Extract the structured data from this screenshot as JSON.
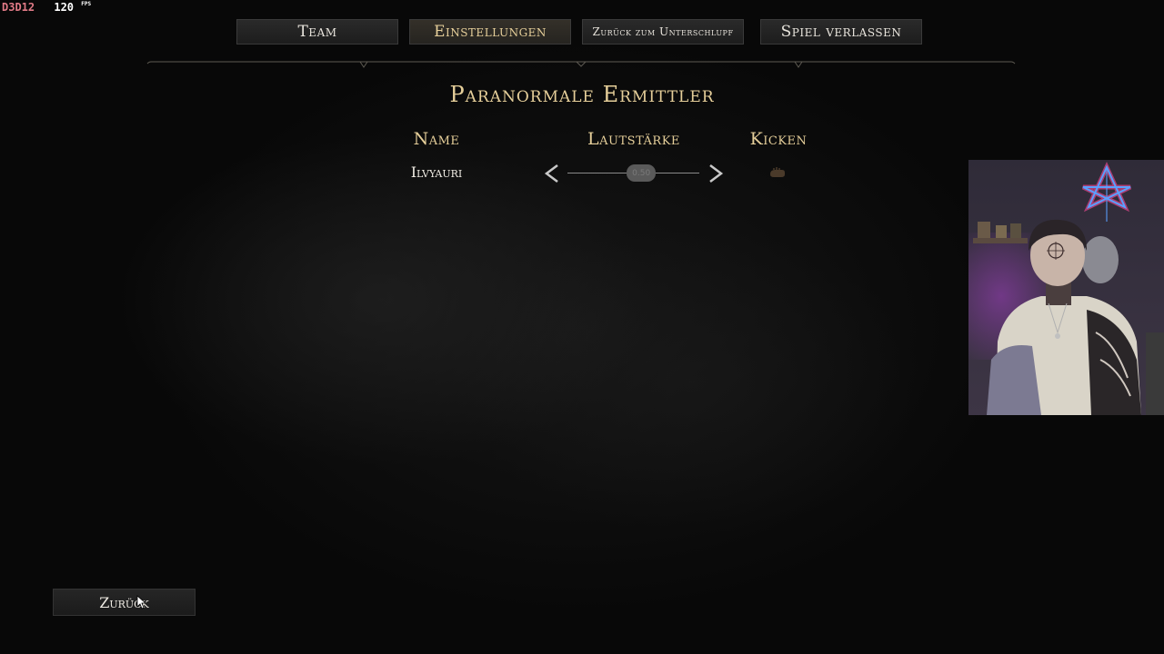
{
  "overlay": {
    "api": "D3D12",
    "fps_value": "120",
    "fps_unit": "FPS"
  },
  "nav": {
    "team": "Team",
    "settings": "Einstellungen",
    "back_to_shelter": "Zurück zum Unterschlupf",
    "leave_game": "Spiel verlassen",
    "active_tab": "Einstellungen"
  },
  "lobby": {
    "title": "Paranormale Ermittler",
    "columns": {
      "name": "Name",
      "volume": "Lautstärke",
      "kick": "Kicken"
    },
    "players": [
      {
        "name": "Ilvyauri",
        "volume_label": "0.50",
        "volume_fraction": 0.56,
        "kick_icon": "hand-icon"
      }
    ]
  },
  "footer": {
    "back": "Zurück"
  },
  "colors": {
    "accent_gold": "#e6cf9a",
    "text_light": "#f0ece4",
    "background": "#0b0b0b",
    "fps_api": "#e07a86"
  },
  "icons": {
    "left_arrow": "chevron-left-icon",
    "right_arrow": "chevron-right-icon",
    "kick": "hand-icon",
    "cursor": "mouse-cursor-icon"
  }
}
